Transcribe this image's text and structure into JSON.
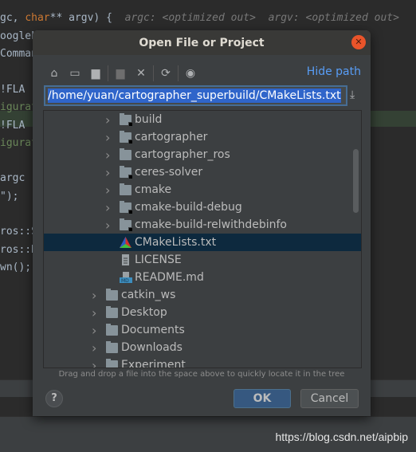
{
  "editor": {
    "line1_code": "gc, ",
    "line1_kw": "char",
    "line1_rest": "** argv) {",
    "line1_hint": "argc: <optimized out>  argv: <optimized out>",
    "lines": [
      "oogleL",
      "Comman",
      "",
      "!FLA",
      "igurat",
      "!FLA",
      "igurat",
      "",
      "argc",
      "\");",
      "",
      "ros::S",
      "ros::R",
      "wn();"
    ]
  },
  "dialog": {
    "title": "Open File or Project",
    "close_icon": "close-icon",
    "toolbar": {
      "icons": [
        "home-icon",
        "desktop-icon",
        "project-folder-icon",
        "new-folder-icon",
        "delete-icon",
        "refresh-icon",
        "show-hidden-icon"
      ],
      "hide_path": "Hide path"
    },
    "path": "/home/yuan/cartographer_superbuild/CMakeLists.txt",
    "tree": [
      {
        "label": "build",
        "type": "folder-locked",
        "level": 1,
        "expandable": true
      },
      {
        "label": "cartographer",
        "type": "folder-locked",
        "level": 1,
        "expandable": true
      },
      {
        "label": "cartographer_ros",
        "type": "folder",
        "level": 1,
        "expandable": true
      },
      {
        "label": "ceres-solver",
        "type": "folder-locked",
        "level": 1,
        "expandable": true
      },
      {
        "label": "cmake",
        "type": "folder",
        "level": 1,
        "expandable": true
      },
      {
        "label": "cmake-build-debug",
        "type": "folder-locked",
        "level": 1,
        "expandable": true
      },
      {
        "label": "cmake-build-relwithdebinfo",
        "type": "folder-locked",
        "level": 1,
        "expandable": true
      },
      {
        "label": "CMakeLists.txt",
        "type": "cmake",
        "level": 1,
        "expandable": false,
        "selected": true
      },
      {
        "label": "LICENSE",
        "type": "text",
        "level": 1,
        "expandable": false
      },
      {
        "label": "README.md",
        "type": "markdown",
        "level": 1,
        "expandable": false
      },
      {
        "label": "catkin_ws",
        "type": "folder",
        "level": 0,
        "expandable": true
      },
      {
        "label": "Desktop",
        "type": "folder",
        "level": 0,
        "expandable": true
      },
      {
        "label": "Documents",
        "type": "folder",
        "level": 0,
        "expandable": true
      },
      {
        "label": "Downloads",
        "type": "folder",
        "level": 0,
        "expandable": true
      },
      {
        "label": "Experiment",
        "type": "folder",
        "level": 0,
        "expandable": true
      }
    ],
    "drag_hint": "Drag and drop a file into the space above to quickly locate it in the tree",
    "help": "?",
    "ok": "OK",
    "cancel": "Cancel"
  },
  "watermark": "https://blog.csdn.net/aipbip",
  "colors": {
    "accent": "#589df6",
    "selection": "#0d293e",
    "ok": "#365880",
    "close": "#e9542a"
  }
}
